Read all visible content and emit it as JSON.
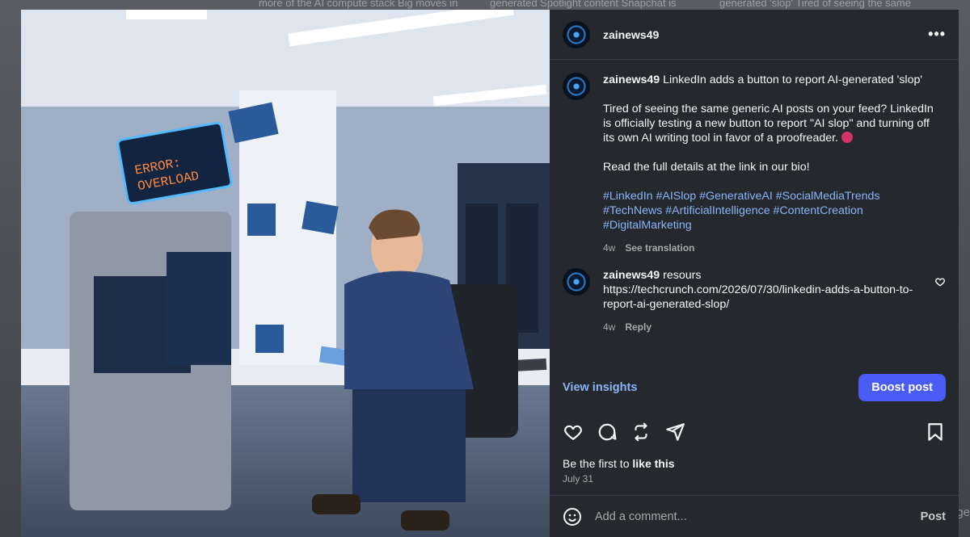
{
  "background": {
    "strip": [
      "more of the AI compute stack Big moves in",
      "generated Spotlight content Snapchat is",
      "generated 'slop' Tired of seeing the same"
    ],
    "right_edge": "ge"
  },
  "post": {
    "username": "zainews49",
    "more_icon": "more-horizontal-icon",
    "caption": {
      "title": "LinkedIn adds a button to report AI-generated 'slop'",
      "paragraph": "Tired of seeing the same generic AI posts on your feed? LinkedIn is officially testing a new button to report \"AI slop\" and turning off its own AI writing tool in favor of a proofreader.",
      "cta": "Read the full details at the link in our bio!",
      "hashtags_line1": "#LinkedIn #AISlop #GenerativeAI #SocialMediaTrends",
      "hashtags_line2": "#TechNews #ArtificialIntelligence #ContentCreation",
      "hashtags_line3": "#DigitalMarketing",
      "age": "4w",
      "see_translation": "See translation"
    },
    "comment": {
      "username": "zainews49",
      "word": "resours",
      "text": "https://techcrunch.com/2026/07/30/linkedin-adds-a-button-to-report-ai-generated-slop/",
      "age": "4w",
      "reply": "Reply"
    },
    "view_insights": "View insights",
    "boost_post": "Boost post",
    "likes_prefix": "Be the first to ",
    "likes_bold": "like this",
    "date": "July 31",
    "comment_placeholder": "Add a comment...",
    "post_button": "Post"
  },
  "colors": {
    "panel_bg": "#25292e",
    "link": "#8ab4f8",
    "boost": "#4a5cf5"
  }
}
